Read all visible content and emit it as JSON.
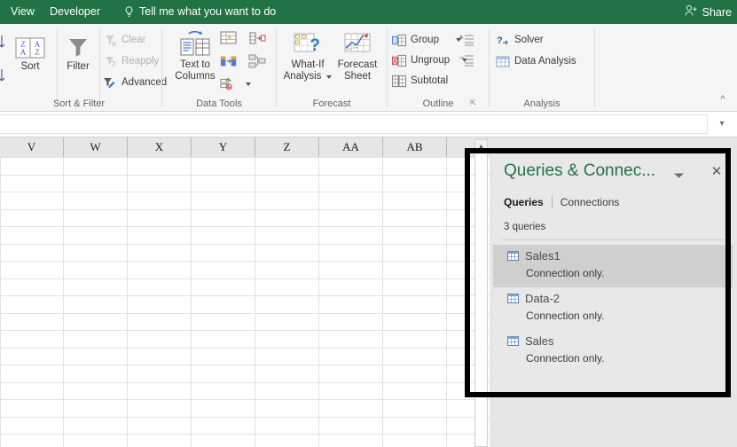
{
  "tabbar": {
    "tabs": [
      {
        "label": "View",
        "name": "tab-view"
      },
      {
        "label": "Developer",
        "name": "tab-developer"
      }
    ],
    "tell_me": "Tell me what you want to do",
    "tell_me_icon": "lightbulb-icon",
    "share_label": "Share",
    "share_icon": "person-add-icon",
    "background_color": "#217346"
  },
  "ribbon": {
    "collapse_icon": "chevron-up-icon",
    "groups": [
      {
        "title": "Sort & Filter",
        "buttons": {
          "sort_az": "sort-ascending-icon",
          "sort_za": "sort-descending-icon",
          "sort": "Sort",
          "filter": "Filter",
          "clear": "Clear",
          "reapply": "Reapply",
          "advanced": "Advanced"
        },
        "disabled": [
          "Clear",
          "Reapply"
        ]
      },
      {
        "title": "Data Tools",
        "buttons": {
          "text_to_columns_line1": "Text to",
          "text_to_columns_line2": "Columns",
          "flash_fill": "flash-fill-icon",
          "remove_duplicates": "remove-duplicates-icon",
          "data_validation": "data-validation-icon",
          "consolidate": "consolidate-icon",
          "relationships": "relationships-icon"
        }
      },
      {
        "title": "Forecast",
        "buttons": {
          "what_if_line1": "What-If",
          "what_if_line2": "Analysis",
          "forecast_line1": "Forecast",
          "forecast_line2": "Sheet"
        }
      },
      {
        "title": "Outline",
        "buttons": {
          "group": "Group",
          "ungroup": "Ungroup",
          "subtotal": "Subtotal",
          "show_detail": "show-detail-icon",
          "hide_detail": "hide-detail-icon"
        },
        "dialog_launcher": "dialog-launcher-icon"
      },
      {
        "title": "Analysis",
        "buttons": {
          "solver": "Solver",
          "data_analysis": "Data Analysis"
        }
      }
    ]
  },
  "formula_bar": {
    "value": "",
    "expand_icon": "chevron-down-icon"
  },
  "sheet": {
    "column_headers": [
      "V",
      "W",
      "X",
      "Y",
      "Z",
      "AA",
      "AB"
    ],
    "scroll_up_icon": "triangle-up-icon"
  },
  "queries_pane": {
    "title": "Queries & Connec...",
    "menu_icon": "chevron-down-icon",
    "close_icon": "close-icon",
    "tabs": [
      {
        "label": "Queries",
        "active": true
      },
      {
        "label": "Connections",
        "active": false
      }
    ],
    "count_label": "3 queries",
    "items": [
      {
        "name": "Sales1",
        "status": "Connection only.",
        "icon": "table-icon",
        "selected": true
      },
      {
        "name": "Data-2",
        "status": "Connection only.",
        "icon": "table-icon",
        "selected": false
      },
      {
        "name": "Sales",
        "status": "Connection only.",
        "icon": "table-icon",
        "selected": false
      }
    ],
    "title_color": "#217346",
    "highlight_color": "#cfcfcf"
  },
  "annotation": {
    "shape": "rectangle",
    "color": "#000000"
  }
}
